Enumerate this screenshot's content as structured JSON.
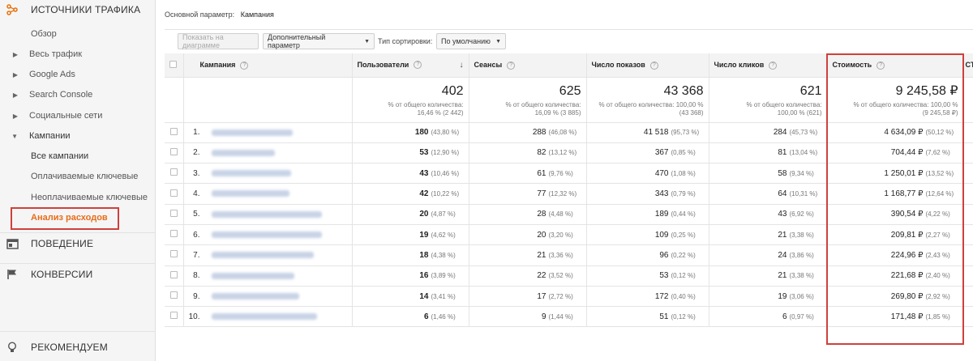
{
  "sidebar": {
    "sections": [
      {
        "label": "ИСТОЧНИКИ ТРАФИКА",
        "icon": "traffic-sources-icon",
        "color": "#e8710a"
      },
      {
        "label": "ПОВЕДЕНИЕ",
        "icon": "behavior-icon"
      },
      {
        "label": "КОНВЕРСИИ",
        "icon": "flag-icon"
      },
      {
        "label": "РЕКОМЕНДУЕМ",
        "icon": "lightbulb-icon"
      }
    ],
    "items": [
      {
        "label": "Обзор"
      },
      {
        "label": "Весь трафик"
      },
      {
        "label": "Google Ads"
      },
      {
        "label": "Search Console"
      },
      {
        "label": "Социальные сети"
      },
      {
        "label": "Кампании"
      },
      {
        "label": "Все кампании"
      },
      {
        "label": "Оплачиваемые ключевые"
      },
      {
        "label": "Неоплачиваемые ключевые"
      },
      {
        "label": "Анализ расходов"
      }
    ],
    "active_color": "#e86c1a",
    "highlight_color": "#d0403c"
  },
  "toolbar": {
    "primary_dim_label": "Основной параметр:",
    "primary_dim_value": "Кампания",
    "chart_button": "Показать на диаграмме",
    "secondary_dim": "Дополнительный параметр",
    "sort_label": "Тип сортировки:",
    "sort_value": "По умолчанию"
  },
  "table": {
    "columns": [
      "Кампания",
      "Пользователи",
      "Сеансы",
      "Число показов",
      "Число кликов",
      "Стоимость",
      "CTR"
    ],
    "totals": [
      {
        "value": "402",
        "pct_label": "% от общего количества:",
        "pct": "16,46 % (2 442)"
      },
      {
        "value": "625",
        "pct_label": "% от общего количества:",
        "pct": "16,09 % (3 885)"
      },
      {
        "value": "43 368",
        "pct_label": "% от общего количества: 100,00 %",
        "pct": "(43 368)"
      },
      {
        "value": "621",
        "pct_label": "% от общего количества:",
        "pct": "100,00 % (621)"
      },
      {
        "value": "9 245,58 ₽",
        "pct_label": "% от общего количества: 100,00 %",
        "pct": "(9 245,58 ₽)"
      }
    ],
    "rows": [
      {
        "idx": "1.",
        "users": "180",
        "users_p": "(43,80 %)",
        "sessions": "288",
        "sessions_p": "(46,08 %)",
        "impr": "41 518",
        "impr_p": "(95,73 %)",
        "clicks": "284",
        "clicks_p": "(45,73 %)",
        "cost": "4 634,09 ₽",
        "cost_p": "(50,12 %)"
      },
      {
        "idx": "2.",
        "users": "53",
        "users_p": "(12,90 %)",
        "sessions": "82",
        "sessions_p": "(13,12 %)",
        "impr": "367",
        "impr_p": "(0,85 %)",
        "clicks": "81",
        "clicks_p": "(13,04 %)",
        "cost": "704,44 ₽",
        "cost_p": "(7,62 %)"
      },
      {
        "idx": "3.",
        "users": "43",
        "users_p": "(10,46 %)",
        "sessions": "61",
        "sessions_p": "(9,76 %)",
        "impr": "470",
        "impr_p": "(1,08 %)",
        "clicks": "58",
        "clicks_p": "(9,34 %)",
        "cost": "1 250,01 ₽",
        "cost_p": "(13,52 %)"
      },
      {
        "idx": "4.",
        "users": "42",
        "users_p": "(10,22 %)",
        "sessions": "77",
        "sessions_p": "(12,32 %)",
        "impr": "343",
        "impr_p": "(0,79 %)",
        "clicks": "64",
        "clicks_p": "(10,31 %)",
        "cost": "1 168,77 ₽",
        "cost_p": "(12,64 %)"
      },
      {
        "idx": "5.",
        "users": "20",
        "users_p": "(4,87 %)",
        "sessions": "28",
        "sessions_p": "(4,48 %)",
        "impr": "189",
        "impr_p": "(0,44 %)",
        "clicks": "43",
        "clicks_p": "(6,92 %)",
        "cost": "390,54 ₽",
        "cost_p": "(4,22 %)"
      },
      {
        "idx": "6.",
        "users": "19",
        "users_p": "(4,62 %)",
        "sessions": "20",
        "sessions_p": "(3,20 %)",
        "impr": "109",
        "impr_p": "(0,25 %)",
        "clicks": "21",
        "clicks_p": "(3,38 %)",
        "cost": "209,81 ₽",
        "cost_p": "(2,27 %)"
      },
      {
        "idx": "7.",
        "users": "18",
        "users_p": "(4,38 %)",
        "sessions": "21",
        "sessions_p": "(3,36 %)",
        "impr": "96",
        "impr_p": "(0,22 %)",
        "clicks": "24",
        "clicks_p": "(3,86 %)",
        "cost": "224,96 ₽",
        "cost_p": "(2,43 %)"
      },
      {
        "idx": "8.",
        "users": "16",
        "users_p": "(3,89 %)",
        "sessions": "22",
        "sessions_p": "(3,52 %)",
        "impr": "53",
        "impr_p": "(0,12 %)",
        "clicks": "21",
        "clicks_p": "(3,38 %)",
        "cost": "221,68 ₽",
        "cost_p": "(2,40 %)"
      },
      {
        "idx": "9.",
        "users": "14",
        "users_p": "(3,41 %)",
        "sessions": "17",
        "sessions_p": "(2,72 %)",
        "impr": "172",
        "impr_p": "(0,40 %)",
        "clicks": "19",
        "clicks_p": "(3,06 %)",
        "cost": "269,80 ₽",
        "cost_p": "(2,92 %)"
      },
      {
        "idx": "10.",
        "users": "6",
        "users_p": "(1,46 %)",
        "sessions": "9",
        "sessions_p": "(1,44 %)",
        "impr": "51",
        "impr_p": "(0,12 %)",
        "clicks": "6",
        "clicks_p": "(0,97 %)",
        "cost": "171,48 ₽",
        "cost_p": "(1,85 %)"
      }
    ]
  }
}
